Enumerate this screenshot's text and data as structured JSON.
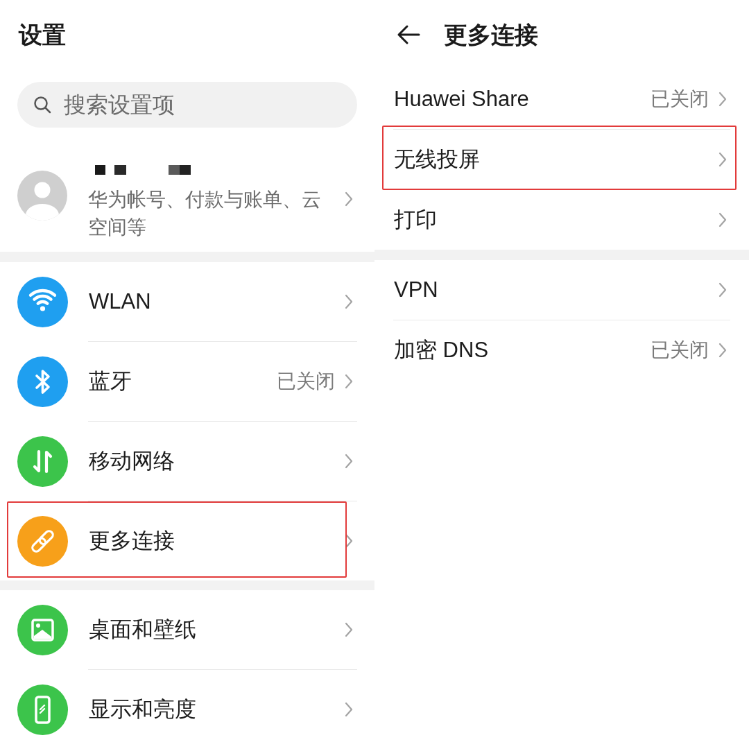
{
  "settings": {
    "title": "设置",
    "search": {
      "placeholder": "搜索设置项"
    },
    "account": {
      "subtitle": "华为帐号、付款与账单、云空间等"
    },
    "sections": [
      {
        "items": [
          {
            "label": "WLAN",
            "color": "#1f9ff0",
            "highlighted": false
          },
          {
            "label": "蓝牙",
            "status": "已关闭",
            "color": "#1f9ff0",
            "highlighted": false
          },
          {
            "label": "移动网络",
            "color": "#3cc44b",
            "highlighted": false
          },
          {
            "label": "更多连接",
            "color": "#f7a01a",
            "highlighted": true
          }
        ]
      },
      {
        "items": [
          {
            "label": "桌面和壁纸",
            "color": "#3cc44b",
            "highlighted": false
          },
          {
            "label": "显示和亮度",
            "color": "#3cc44b",
            "highlighted": false
          }
        ]
      }
    ]
  },
  "more_connections": {
    "title": "更多连接",
    "sections": [
      {
        "items": [
          {
            "label": "Huawei Share",
            "status": "已关闭",
            "highlighted": false
          },
          {
            "label": "无线投屏",
            "highlighted": true
          },
          {
            "label": "打印",
            "highlighted": false
          }
        ]
      },
      {
        "items": [
          {
            "label": "VPN",
            "highlighted": false
          },
          {
            "label": "加密 DNS",
            "status": "已关闭",
            "highlighted": false
          }
        ]
      }
    ]
  }
}
